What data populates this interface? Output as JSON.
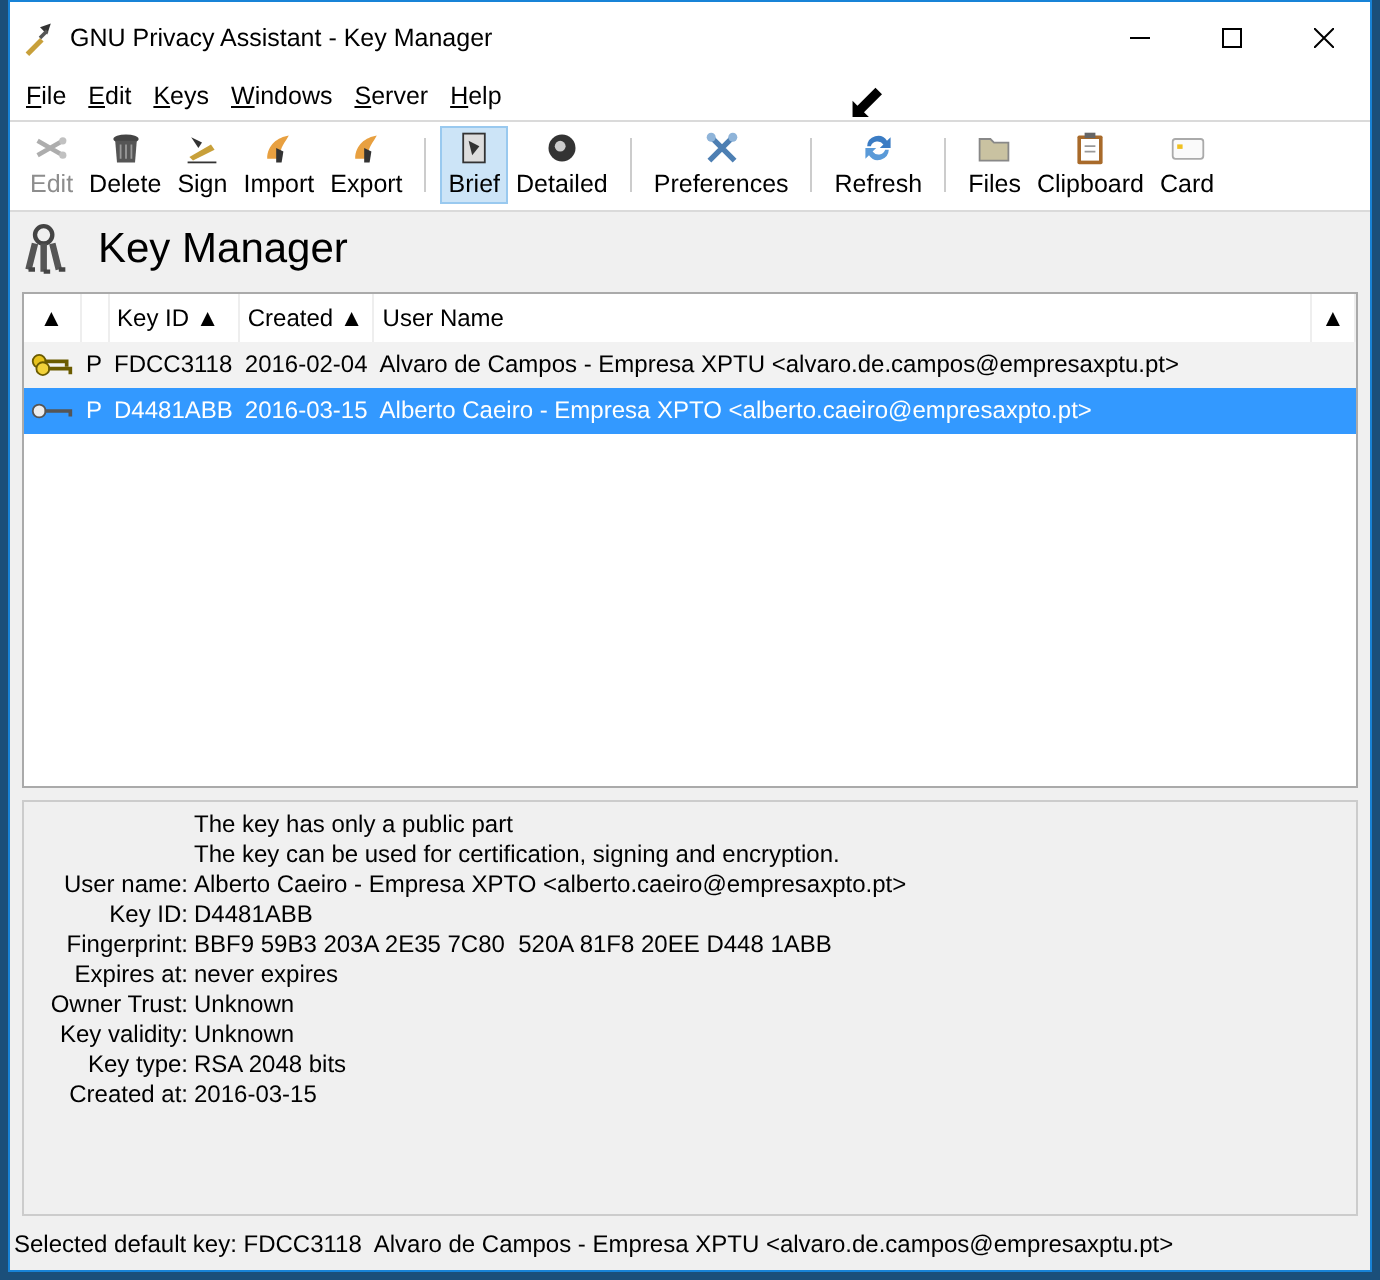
{
  "window": {
    "title": "GNU Privacy Assistant - Key Manager"
  },
  "menu": [
    {
      "label": "File"
    },
    {
      "label": "Edit"
    },
    {
      "label": "Keys"
    },
    {
      "label": "Windows"
    },
    {
      "label": "Server"
    },
    {
      "label": "Help"
    }
  ],
  "toolbar": [
    {
      "kind": "button",
      "label": "Edit",
      "disabled": true,
      "selected": false
    },
    {
      "kind": "button",
      "label": "Delete",
      "disabled": false,
      "selected": false
    },
    {
      "kind": "button",
      "label": "Sign",
      "disabled": false,
      "selected": false
    },
    {
      "kind": "button",
      "label": "Import",
      "disabled": false,
      "selected": false
    },
    {
      "kind": "button",
      "label": "Export",
      "disabled": false,
      "selected": false
    },
    {
      "kind": "separator"
    },
    {
      "kind": "button",
      "label": "Brief",
      "disabled": false,
      "selected": true
    },
    {
      "kind": "button",
      "label": "Detailed",
      "disabled": false,
      "selected": false
    },
    {
      "kind": "separator"
    },
    {
      "kind": "button",
      "label": "Preferences",
      "disabled": false,
      "selected": false
    },
    {
      "kind": "separator"
    },
    {
      "kind": "button",
      "label": "Refresh",
      "disabled": false,
      "selected": false
    },
    {
      "kind": "separator"
    },
    {
      "kind": "button",
      "label": "Files",
      "disabled": false,
      "selected": false
    },
    {
      "kind": "button",
      "label": "Clipboard",
      "disabled": false,
      "selected": false
    },
    {
      "kind": "button",
      "label": "Card",
      "disabled": false,
      "selected": false
    }
  ],
  "heading": "Key Manager",
  "table": {
    "columns": [
      {
        "label": "▲"
      },
      {},
      {
        "label": "Key ID ▲"
      },
      {
        "label": "Created ▲"
      },
      {
        "label": "User Name"
      },
      {
        "label": "▲"
      }
    ],
    "rows": [
      {
        "kind": "pair",
        "type": "P",
        "key_id": "FDCC3118",
        "created": "2016-02-04",
        "user_name": "Alvaro de Campos - Empresa XPTU <alvaro.de.campos@empresaxptu.pt>",
        "selected": false
      },
      {
        "kind": "public",
        "type": "P",
        "key_id": "D4481ABB",
        "created": "2016-03-15",
        "user_name": "Alberto Caeiro - Empresa XPTO <alberto.caeiro@empresaxpto.pt>",
        "selected": true
      }
    ]
  },
  "details": {
    "notes": [
      "The key has only a public part",
      "The key can be used for certification, signing and encryption."
    ],
    "fields": [
      {
        "label": "User name:",
        "value": "Alberto Caeiro - Empresa XPTO <alberto.caeiro@empresaxpto.pt>"
      },
      {
        "label": "Key ID:",
        "value": "D4481ABB"
      },
      {
        "label": "Fingerprint:",
        "value": "BBF9 59B3 203A 2E35 7C80  520A 81F8 20EE D448 1ABB"
      },
      {
        "label": "Expires at:",
        "value": "never expires"
      },
      {
        "label": "Owner Trust:",
        "value": "Unknown"
      },
      {
        "label": "Key validity:",
        "value": "Unknown"
      },
      {
        "label": "Key type:",
        "value": "RSA 2048 bits"
      },
      {
        "label": "Created at:",
        "value": "2016-03-15"
      }
    ]
  },
  "status_bar": {
    "label": "Selected default key:",
    "value": "FDCC3118  Alvaro de Campos - Empresa XPTU <alvaro.de.campos@empresaxptu.pt>"
  }
}
